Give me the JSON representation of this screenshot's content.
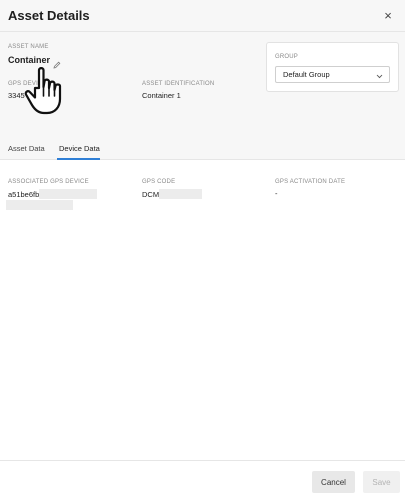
{
  "header": {
    "title": "Asset Details",
    "close_symbol": "×"
  },
  "details": {
    "asset_name_label": "ASSET NAME",
    "asset_name_value": "Container",
    "gps_device_label": "GPS DEVICE",
    "gps_device_value": "3345",
    "asset_identification_label": "ASSET IDENTIFICATION",
    "asset_identification_value": "Container 1"
  },
  "group": {
    "label": "GROUP",
    "selected": "Default Group"
  },
  "tabs": [
    {
      "label": "Asset Data",
      "active": false
    },
    {
      "label": "Device Data",
      "active": true
    }
  ],
  "device_data": {
    "associated_gps_label": "ASSOCIATED GPS DEVICE",
    "associated_gps_value": "a51be6fb",
    "gps_code_label": "GPS CODE",
    "gps_code_value": "DCM",
    "gps_activation_label": "GPS ACTIVATION DATE",
    "gps_activation_value": "-"
  },
  "footer": {
    "cancel_label": "Cancel",
    "save_label": "Save"
  },
  "colors": {
    "accent": "#2f7fd6",
    "panel_bg": "#f7f7f7",
    "redaction": "#ececec"
  },
  "icons": {
    "edit": "pencil-icon",
    "dropdown": "chevron-down-icon",
    "close": "close-icon",
    "cursor": "hand-pointer-icon"
  }
}
